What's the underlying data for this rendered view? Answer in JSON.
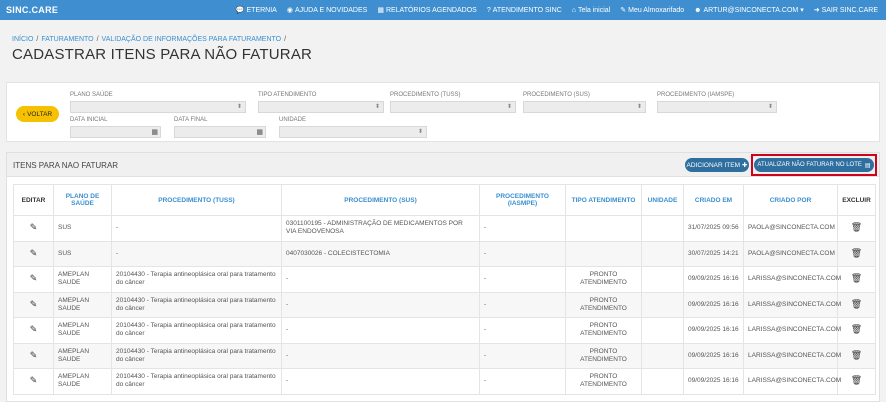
{
  "topbar": {
    "brand": "SINC.CARE",
    "nav": [
      {
        "icon": "chat-icon",
        "glyph": "💬",
        "label": "ETERNIA"
      },
      {
        "icon": "rss-icon",
        "glyph": "◉",
        "label": "AJUDA E NOVIDADES"
      },
      {
        "icon": "calendar-icon",
        "glyph": "▦",
        "label": "RELATÓRIOS AGENDADOS"
      },
      {
        "icon": "question-icon",
        "glyph": "?",
        "label": "ATENDIMENTO SINC"
      },
      {
        "icon": "home-icon",
        "glyph": "⌂",
        "label": "Tela inicial"
      },
      {
        "icon": "edit-icon",
        "glyph": "✎",
        "label": "Meu Almoxarifado"
      },
      {
        "icon": "user-icon",
        "glyph": "☻",
        "label": "ARTUR@SINCONECTA.COM ▾"
      },
      {
        "icon": "logout-icon",
        "glyph": "➜",
        "label": "SAIR SINC.CARE"
      }
    ]
  },
  "breadcrumb": {
    "items": [
      "INÍCIO",
      "FATURAMENTO",
      "VALIDAÇÃO DE INFORMAÇÕES PARA FATURAMENTO"
    ],
    "sep": "/"
  },
  "page_title": "CADASTRAR ITENS PARA NÃO FATURAR",
  "filters": {
    "back_label": "VOLTAR",
    "plano_saude": "PLANO SAÚDE",
    "tipo_atendimento": "TIPO ATENDIMENTO",
    "proc_tuss": "PROCEDIMENTO (TUSS)",
    "proc_sus": "PROCEDIMENTO (SUS)",
    "proc_iamspe": "PROCEDIMENTO (IAMSPE)",
    "data_inicial": "DATA INICIAL",
    "data_final": "DATA FINAL",
    "unidade": "UNIDADE"
  },
  "panel": {
    "title": "ITENS PARA NAO FATURAR",
    "add_label": "ADICIONAR ITEM",
    "update_label": "ATUALIZAR NÃO FATURAR NO LOTE"
  },
  "table": {
    "headers": [
      "EDITAR",
      "PLANO DE SAÚDE",
      "PROCEDIMENTO (TUSS)",
      "PROCEDIMENTO (SUS)",
      "PROCEDIMENTO (IASMPE)",
      "TIPO ATENDIMENTO",
      "UNIDADE",
      "CRIADO EM",
      "CRIADO POR",
      "EXCLUIR"
    ],
    "rows": [
      {
        "plano": "SUS",
        "tuss": "-",
        "sus": "0301100195 - ADMINISTRAÇÃO DE MEDICAMENTOS POR VIA ENDOVENOSA",
        "iamspe": "-",
        "tipo": "",
        "unidade": "",
        "criado_em": "31/07/2025 09:56",
        "criado_por": "PAOLA@SINCONECTA.COM"
      },
      {
        "plano": "SUS",
        "tuss": "-",
        "sus": "0407030026 - COLECISTECTOMIA",
        "iamspe": "-",
        "tipo": "",
        "unidade": "",
        "criado_em": "30/07/2025 14:21",
        "criado_por": "PAOLA@SINCONECTA.COM"
      },
      {
        "plano": "AMEPLAN SAUDE",
        "tuss": "20104430 - Terapia antineoplásica oral para tratamento do câncer",
        "sus": "-",
        "iamspe": "-",
        "tipo": "PRONTO ATENDIMENTO",
        "unidade": "",
        "criado_em": "09/09/2025 16:16",
        "criado_por": "LARISSA@SINCONECTA.COM"
      },
      {
        "plano": "AMEPLAN SAUDE",
        "tuss": "20104430 - Terapia antineoplásica oral para tratamento do câncer",
        "sus": "-",
        "iamspe": "-",
        "tipo": "PRONTO ATENDIMENTO",
        "unidade": "",
        "criado_em": "09/09/2025 16:16",
        "criado_por": "LARISSA@SINCONECTA.COM"
      },
      {
        "plano": "AMEPLAN SAUDE",
        "tuss": "20104430 - Terapia antineoplásica oral para tratamento do câncer",
        "sus": "-",
        "iamspe": "-",
        "tipo": "PRONTO ATENDIMENTO",
        "unidade": "",
        "criado_em": "09/09/2025 16:16",
        "criado_por": "LARISSA@SINCONECTA.COM"
      },
      {
        "plano": "AMEPLAN SAUDE",
        "tuss": "20104430 - Terapia antineoplásica oral para tratamento do câncer",
        "sus": "-",
        "iamspe": "-",
        "tipo": "PRONTO ATENDIMENTO",
        "unidade": "",
        "criado_em": "09/09/2025 16:16",
        "criado_por": "LARISSA@SINCONECTA.COM"
      },
      {
        "plano": "AMEPLAN SAUDE",
        "tuss": "20104430 - Terapia antineoplásica oral para tratamento do câncer",
        "sus": "-",
        "iamspe": "-",
        "tipo": "PRONTO ATENDIMENTO",
        "unidade": "",
        "criado_em": "09/09/2025 16:16",
        "criado_por": "LARISSA@SINCONECTA.COM"
      }
    ]
  },
  "colors": {
    "topbar": "#3f8fd0",
    "accent": "#3a8fd0",
    "button": "#2f6f9f",
    "back": "#f6c100",
    "highlight": "#d0021b"
  }
}
